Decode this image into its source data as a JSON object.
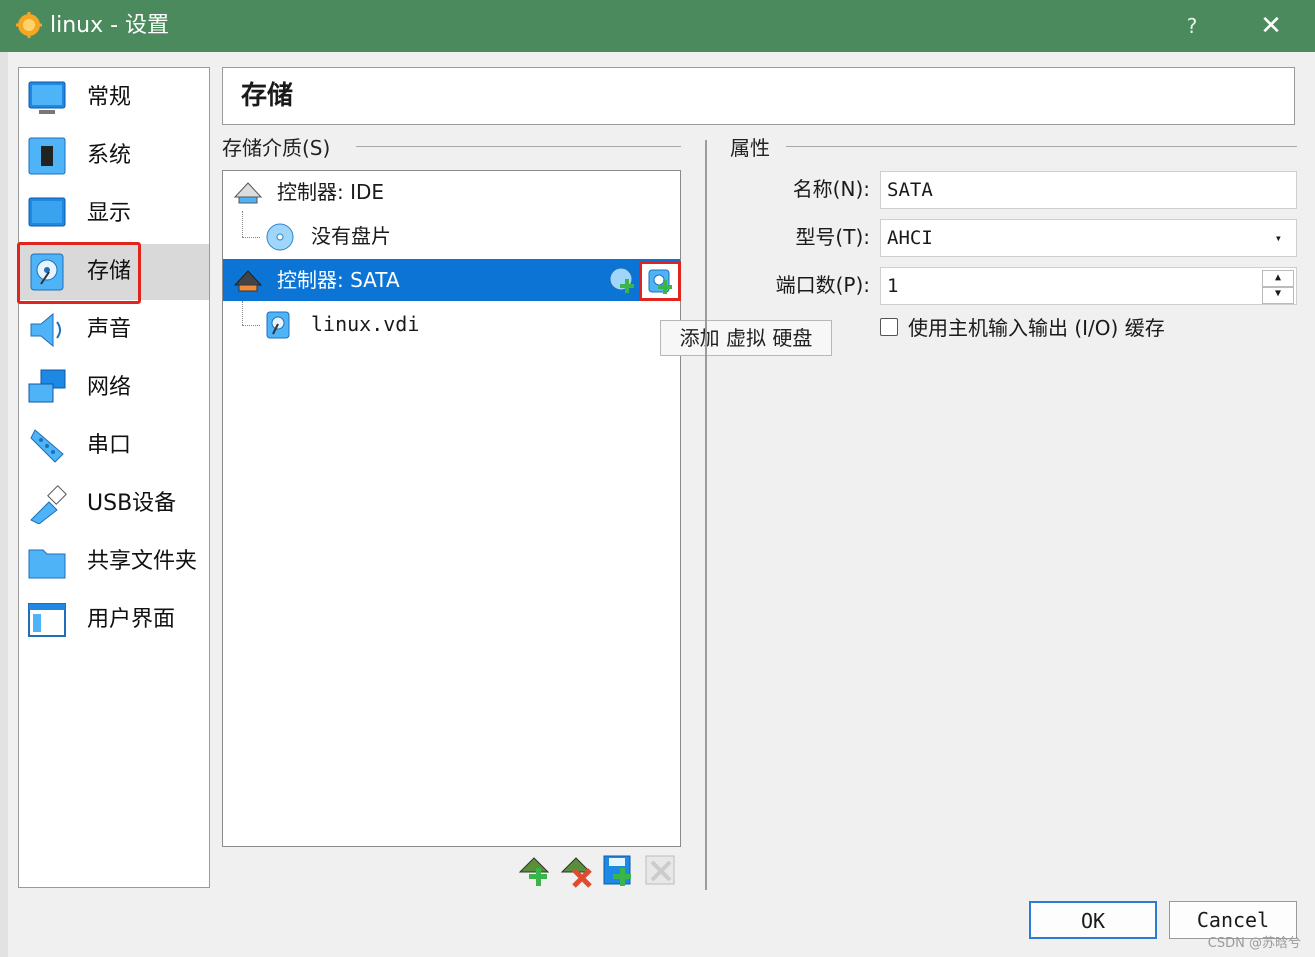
{
  "window": {
    "title": "linux - 设置",
    "help_glyph": "?",
    "close_glyph": "✕"
  },
  "sidebar": {
    "items": [
      {
        "label": "常规",
        "icon": "general-icon"
      },
      {
        "label": "系统",
        "icon": "system-icon"
      },
      {
        "label": "显示",
        "icon": "display-icon"
      },
      {
        "label": "存储",
        "icon": "storage-icon",
        "selected": true
      },
      {
        "label": "声音",
        "icon": "audio-icon"
      },
      {
        "label": "网络",
        "icon": "network-icon"
      },
      {
        "label": "串口",
        "icon": "serial-port-icon"
      },
      {
        "label": "USB设备",
        "icon": "usb-icon"
      },
      {
        "label": "共享文件夹",
        "icon": "shared-folder-icon"
      },
      {
        "label": "用户界面",
        "icon": "user-interface-icon"
      }
    ]
  },
  "header": {
    "title": "存储"
  },
  "storage": {
    "section_label": "存储介质(S)",
    "tree": [
      {
        "label": "控制器: IDE",
        "kind": "controller"
      },
      {
        "label": "没有盘片",
        "kind": "optical-disk"
      },
      {
        "label": "控制器: SATA",
        "kind": "controller",
        "selected": true
      },
      {
        "label": "linux.vdi",
        "kind": "hard-disk"
      }
    ],
    "tooltip": "添加 虚拟 硬盘",
    "toolbar": [
      "add-controller-icon",
      "remove-controller-icon",
      "add-attachment-icon",
      "remove-attachment-icon"
    ]
  },
  "properties": {
    "section_label": "属性",
    "name_label": "名称(N):",
    "name_value": "SATA",
    "type_label": "型号(T):",
    "type_value": "AHCI",
    "ports_label": "端口数(P):",
    "ports_value": "1",
    "cache_label": "使用主机输入输出 (I/O) 缓存",
    "cache_checked": false
  },
  "buttons": {
    "ok": "OK",
    "cancel": "Cancel"
  },
  "watermark": "CSDN @苏晗兮",
  "colors": {
    "titlebar": "#4a8a5c",
    "selection": "#0b74d4",
    "highlight": "#e0251e"
  }
}
